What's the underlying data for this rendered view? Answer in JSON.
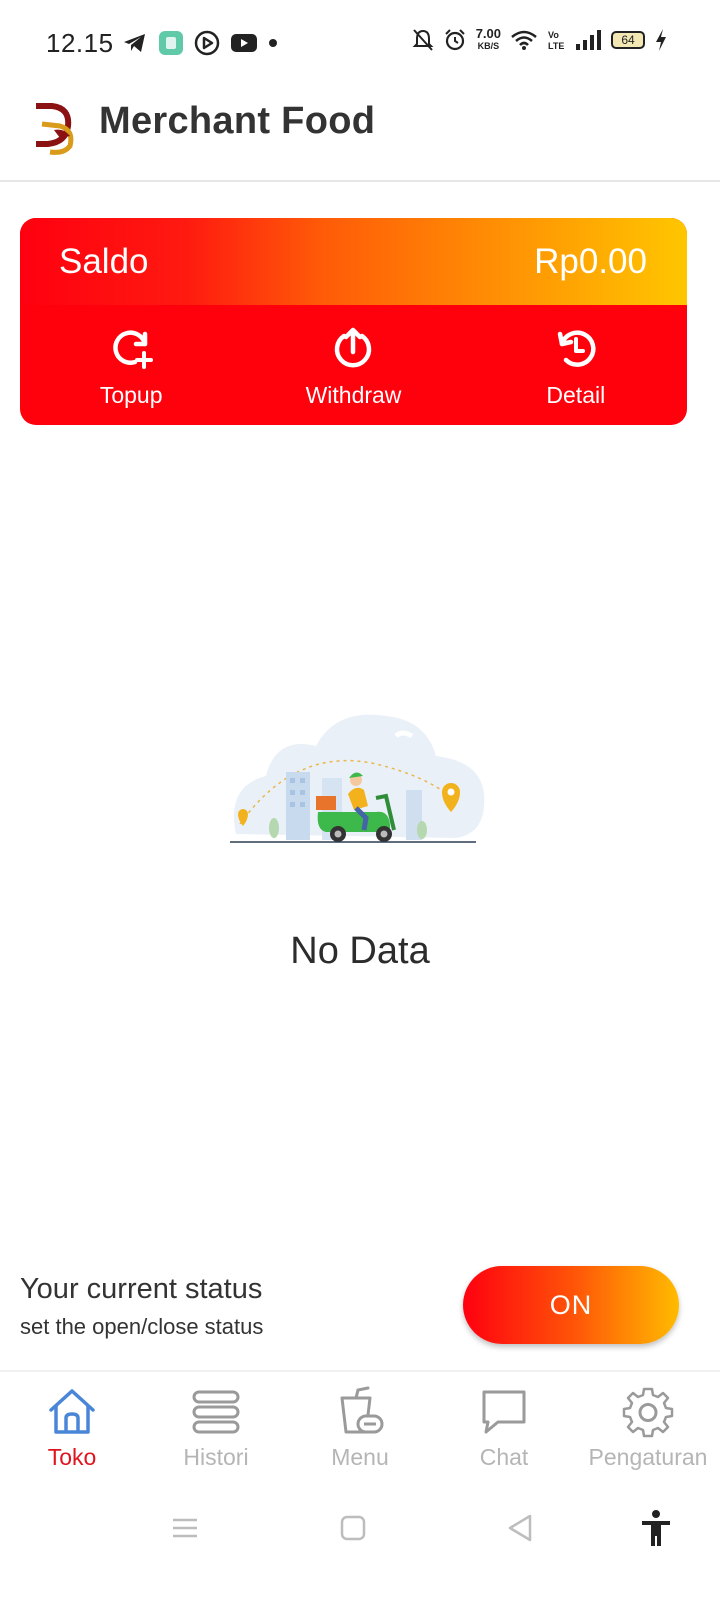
{
  "status_bar": {
    "time": "12.15",
    "net_speed_value": "7.00",
    "net_speed_unit": "KB/S",
    "volte": "Vo LTE",
    "battery": "64"
  },
  "app_bar": {
    "title": "Merchant Food",
    "logo_icon": "merchant-logo"
  },
  "balance": {
    "label": "Saldo",
    "value": "Rp0.00",
    "actions": [
      {
        "label": "Topup",
        "icon": "topup-icon"
      },
      {
        "label": "Withdraw",
        "icon": "withdraw-icon"
      },
      {
        "label": "Detail",
        "icon": "history-icon"
      }
    ]
  },
  "empty_state": {
    "text": "No Data",
    "illustration": "delivery-scooter-illustration"
  },
  "store_status": {
    "title": "Your current status",
    "subtitle": "set the open/close status",
    "toggle_label": "ON"
  },
  "bottom_nav": {
    "items": [
      {
        "label": "Toko",
        "icon": "home-icon",
        "active": true
      },
      {
        "label": "Histori",
        "icon": "list-icon",
        "active": false
      },
      {
        "label": "Menu",
        "icon": "food-menu-icon",
        "active": false
      },
      {
        "label": "Chat",
        "icon": "chat-icon",
        "active": false
      },
      {
        "label": "Pengaturan",
        "icon": "gear-icon",
        "active": false
      }
    ]
  },
  "colors": {
    "primary_red": "#ff000d",
    "accent_yellow": "#ffc600",
    "active_nav": "#e0141e",
    "inactive_nav": "#b5b5b5"
  }
}
